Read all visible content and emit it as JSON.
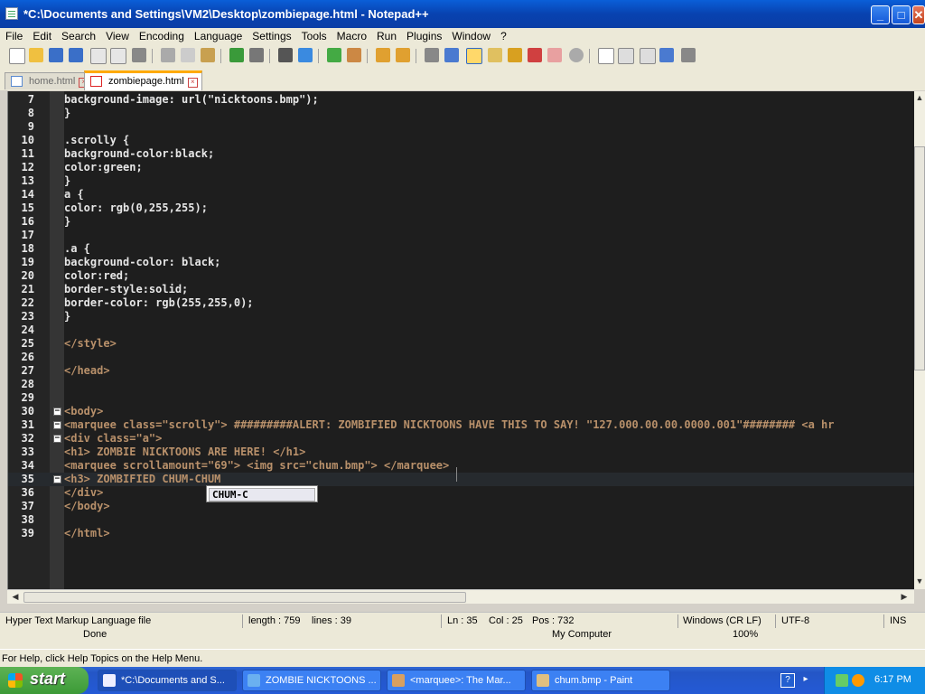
{
  "window": {
    "title": "*C:\\Documents and Settings\\VM2\\Desktop\\zombiepage.html - Notepad++",
    "minimize": "_",
    "maximize": "□",
    "close": "✕"
  },
  "menu": [
    "File",
    "Edit",
    "Search",
    "View",
    "Encoding",
    "Language",
    "Settings",
    "Tools",
    "Macro",
    "Run",
    "Plugins",
    "Window",
    "?"
  ],
  "tabs": [
    {
      "label": "home.html",
      "active": false
    },
    {
      "label": "zombiepage.html",
      "active": true
    }
  ],
  "editor": {
    "lines": [
      {
        "n": "7",
        "text": "background-image: url(\"nicktoons.bmp\");"
      },
      {
        "n": "8",
        "text": "}"
      },
      {
        "n": "9",
        "text": ""
      },
      {
        "n": "10",
        "text": ".scrolly {"
      },
      {
        "n": "11",
        "text": "background-color:black;"
      },
      {
        "n": "12",
        "text": "color:green;"
      },
      {
        "n": "13",
        "text": "}"
      },
      {
        "n": "14",
        "text": "a {"
      },
      {
        "n": "15",
        "text": "color: rgb(0,255,255);"
      },
      {
        "n": "16",
        "text": "}"
      },
      {
        "n": "17",
        "text": ""
      },
      {
        "n": "18",
        "text": ".a {"
      },
      {
        "n": "19",
        "text": "background-color: black;"
      },
      {
        "n": "20",
        "text": "color:red;"
      },
      {
        "n": "21",
        "text": "border-style:solid;"
      },
      {
        "n": "22",
        "text": "border-color: rgb(255,255,0);"
      },
      {
        "n": "23",
        "text": "}"
      },
      {
        "n": "24",
        "text": ""
      },
      {
        "n": "25",
        "text": "</style>"
      },
      {
        "n": "26",
        "text": ""
      },
      {
        "n": "27",
        "text": "</head>"
      },
      {
        "n": "28",
        "text": ""
      },
      {
        "n": "29",
        "text": ""
      },
      {
        "n": "30",
        "text": "<body>"
      },
      {
        "n": "31",
        "text": "<marquee class=\"scrolly\"> #########ALERT: ZOMBIFIED NICKTOONS HAVE THIS TO SAY! \"127.000.00.00.0000.001\"######## <a hr"
      },
      {
        "n": "32",
        "text": "<div class=\"a\">"
      },
      {
        "n": "33",
        "text": "<h1> ZOMBIE NICKTOONS ARE HERE! </h1>"
      },
      {
        "n": "34",
        "text": "<marquee scrollamount=\"69\"> <img src=\"chum.bmp\"> </marquee>"
      },
      {
        "n": "35",
        "text": "<h3> ZOMBIFIED CHUM-CHUM"
      },
      {
        "n": "36",
        "text": "</div>"
      },
      {
        "n": "37",
        "text": "</body>"
      },
      {
        "n": "38",
        "text": ""
      },
      {
        "n": "39",
        "text": "</html>"
      }
    ],
    "current_line": "35",
    "autocomplete": "CHUM-C"
  },
  "status": {
    "filetype": "Hyper Text Markup Language file",
    "length": "length : 759",
    "lines": "lines : 39",
    "ln": "Ln : 35",
    "col": "Col : 25",
    "pos": "Pos : 732",
    "eol": "Windows (CR LF)",
    "encoding": "UTF-8",
    "mode": "INS"
  },
  "behind_window": {
    "done": "Done",
    "zone": "My Computer",
    "zoom": "100%"
  },
  "helpbar": "For Help, click Help Topics on the Help Menu.",
  "taskbar": {
    "start": "start",
    "tasks": [
      "*C:\\Documents and S...",
      "ZOMBIE NICKTOONS ...",
      "<marquee>: The Mar...",
      "chum.bmp - Paint"
    ],
    "clock": "6:17 PM"
  },
  "colors": {
    "editor_bg": "#1e1e1e",
    "titlebar": "#0a5fd8",
    "taskbar": "#245ad6"
  }
}
